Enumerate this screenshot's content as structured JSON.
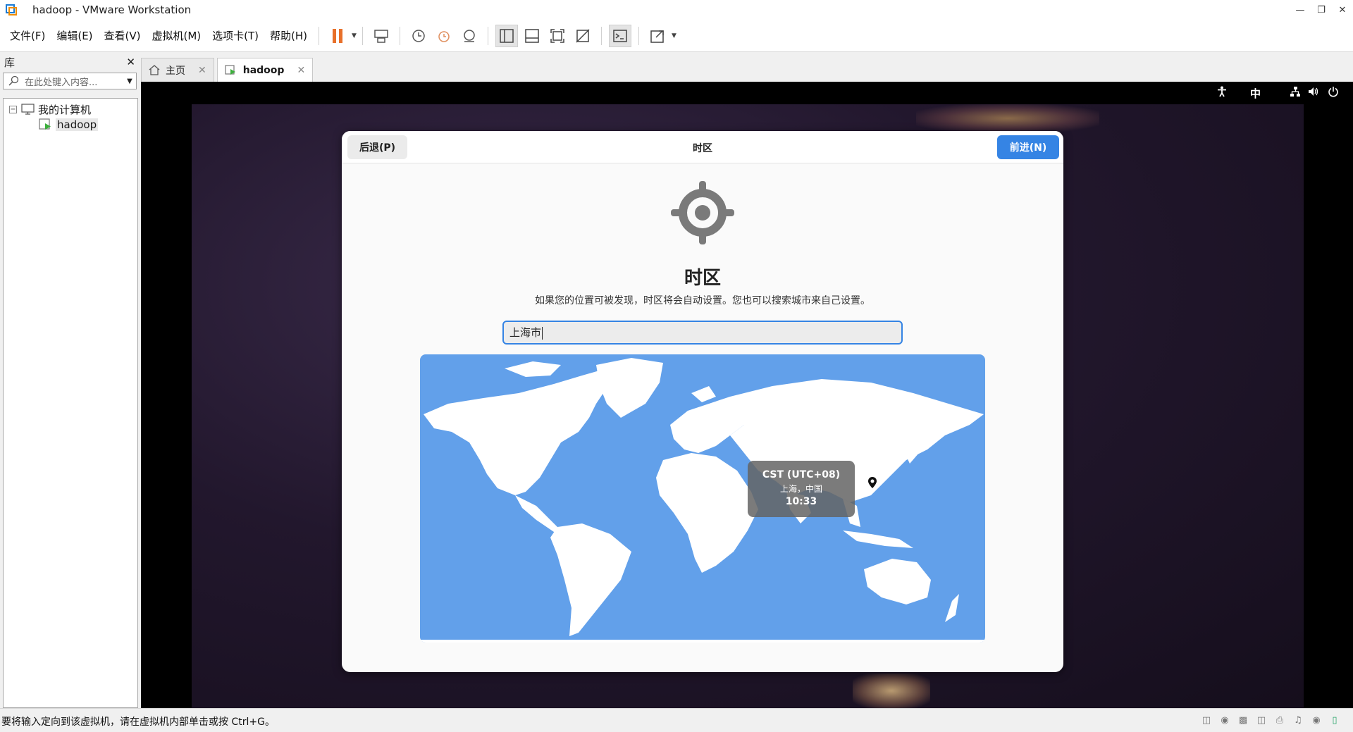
{
  "window": {
    "title": "hadoop - VMware Workstation"
  },
  "menu": {
    "items": [
      "文件(F)",
      "编辑(E)",
      "查看(V)",
      "虚拟机(M)",
      "选项卡(T)",
      "帮助(H)"
    ]
  },
  "library": {
    "title": "库",
    "search_placeholder": "在此处键入内容...",
    "tree": {
      "root": "我的计算机",
      "child": "hadoop"
    }
  },
  "tabs": [
    {
      "label": "主页"
    },
    {
      "label": "hadoop"
    }
  ],
  "vm_topbar": {
    "input_method": "中"
  },
  "installer": {
    "header_title": "时区",
    "back_label": "后退(P)",
    "next_label": "前进(N)",
    "heading": "时区",
    "description": "如果您的位置可被发现，时区将会自动设置。您也可以搜索城市来自己设置。",
    "search_value": "上海市",
    "map_tooltip": {
      "zone": "CST (UTC+08)",
      "location": "上海，中国",
      "time": "10:33"
    }
  },
  "statusbar": {
    "message": "要将输入定向到该虚拟机，请在虚拟机内部单击或按 Ctrl+G。"
  },
  "colors": {
    "accent": "#3584e4",
    "map_ocean": "#62a0ea",
    "pause_icon": "#e8702a"
  }
}
